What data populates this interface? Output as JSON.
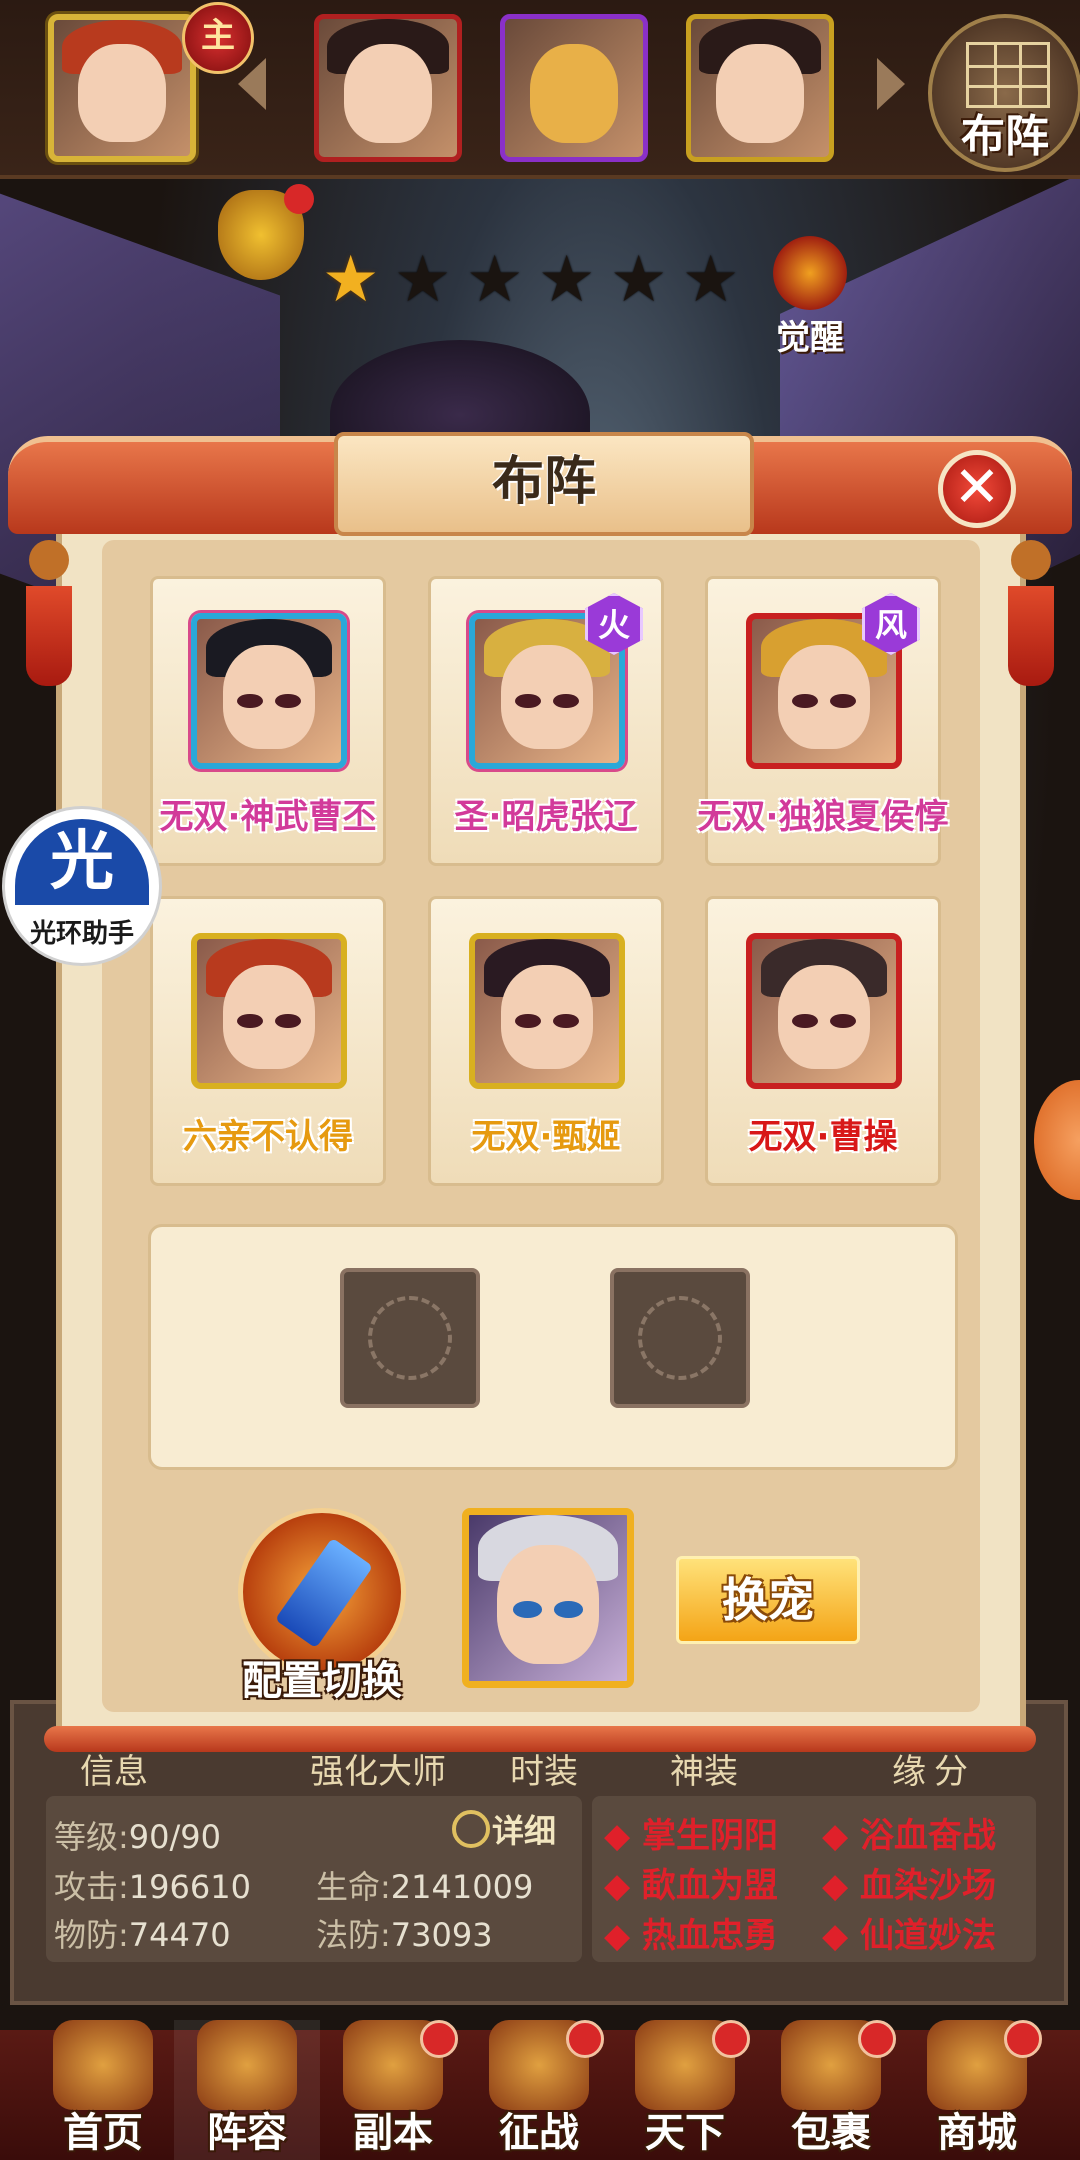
{
  "top_bar": {
    "leader_badge": "主",
    "formation_button": "布阵"
  },
  "hero_status": {
    "stars_total": 6,
    "stars_filled": 1,
    "awaken_label": "觉醒"
  },
  "dialog": {
    "title": "布阵",
    "close_icon": "✕",
    "heroes": [
      {
        "name": "无双·神武曹丕",
        "name_color": "pink",
        "frame": "rainbow",
        "element": ""
      },
      {
        "name": "圣·昭虎张辽",
        "name_color": "pink",
        "frame": "rainbow",
        "element": "火"
      },
      {
        "name": "无双·独狼夏侯惇",
        "name_color": "pink",
        "frame": "red",
        "element": "风"
      },
      {
        "name": "六亲不认得",
        "name_color": "orange",
        "frame": "yellow",
        "element": ""
      },
      {
        "name": "无双·甄姬",
        "name_color": "orange",
        "frame": "yellow",
        "element": ""
      },
      {
        "name": "无双·曹操",
        "name_color": "red",
        "frame": "red",
        "element": ""
      }
    ],
    "config_switch_label": "配置切换",
    "swap_pet_label": "换宠"
  },
  "helper": {
    "icon_char": "光",
    "label": "光环助手"
  },
  "info": {
    "tabs": [
      "信息",
      "强化大师",
      "时装",
      "神装",
      "缘",
      "分"
    ],
    "detail_label": "详细",
    "level_label": "等级:",
    "level_value": "90/90",
    "attack_label": "攻击:",
    "attack_value": "196610",
    "hp_label": "生命:",
    "hp_value": "2141009",
    "pdef_label": "物防:",
    "pdef_value": "74470",
    "mdef_label": "法防:",
    "mdef_value": "73093",
    "skills": [
      "掌生阴阳",
      "浴血奋战",
      "歃血为盟",
      "血染沙场",
      "热血忠勇",
      "仙道妙法"
    ]
  },
  "nav": [
    {
      "label": "首页",
      "dot": false
    },
    {
      "label": "阵容",
      "dot": false,
      "active": true
    },
    {
      "label": "副本",
      "dot": true
    },
    {
      "label": "征战",
      "dot": true
    },
    {
      "label": "天下",
      "dot": true
    },
    {
      "label": "包裹",
      "dot": true
    },
    {
      "label": "商城",
      "dot": true
    }
  ]
}
